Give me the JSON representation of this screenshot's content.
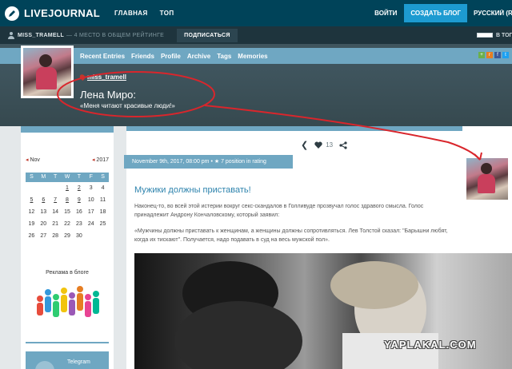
{
  "topbar": {
    "logo_text": "LIVEJOURNAL",
    "nav": [
      "ГЛАВНАЯ",
      "ТОП"
    ],
    "login": "ВОЙТИ",
    "create_blog": "СОЗДАТЬ БЛОГ",
    "language": "РУССКИЙ (RU)"
  },
  "journal_bar": {
    "username": "MISS_TRAMELL",
    "rank_text": "— 4 МЕСТО В ОБЩЕМ РЕЙТИНГЕ",
    "subscribe": "ПОДПИСАТЬСЯ",
    "right_label": "В ТОП"
  },
  "header": {
    "nav": [
      "Recent Entries",
      "Friends",
      "Profile",
      "Archive",
      "Tags",
      "Memories"
    ],
    "username_link": "miss_tramell",
    "blog_title": "Лена Миро:",
    "blog_subtitle": "«Меня читают красивые люди!»"
  },
  "calendar": {
    "prev_month": "Nov",
    "next_year": "2017",
    "weekdays": [
      "S",
      "M",
      "T",
      "W",
      "T",
      "F",
      "S"
    ],
    "days": [
      {
        "d": "",
        "link": false
      },
      {
        "d": "",
        "link": false
      },
      {
        "d": "",
        "link": false
      },
      {
        "d": "1",
        "link": true
      },
      {
        "d": "2",
        "link": true
      },
      {
        "d": "3",
        "link": false
      },
      {
        "d": "4",
        "link": false
      },
      {
        "d": "5",
        "link": true
      },
      {
        "d": "6",
        "link": true
      },
      {
        "d": "7",
        "link": true
      },
      {
        "d": "8",
        "link": true
      },
      {
        "d": "9",
        "link": true
      },
      {
        "d": "10",
        "link": false
      },
      {
        "d": "11",
        "link": false
      },
      {
        "d": "12",
        "link": false
      },
      {
        "d": "13",
        "link": false
      },
      {
        "d": "14",
        "link": false
      },
      {
        "d": "15",
        "link": false
      },
      {
        "d": "16",
        "link": false
      },
      {
        "d": "17",
        "link": false
      },
      {
        "d": "18",
        "link": false
      },
      {
        "d": "19",
        "link": false
      },
      {
        "d": "20",
        "link": false
      },
      {
        "d": "21",
        "link": false
      },
      {
        "d": "22",
        "link": false
      },
      {
        "d": "23",
        "link": false
      },
      {
        "d": "24",
        "link": false
      },
      {
        "d": "25",
        "link": false
      },
      {
        "d": "26",
        "link": false
      },
      {
        "d": "27",
        "link": false
      },
      {
        "d": "28",
        "link": false
      },
      {
        "d": "29",
        "link": false
      },
      {
        "d": "30",
        "link": false
      },
      {
        "d": "",
        "link": false
      },
      {
        "d": "",
        "link": false
      }
    ]
  },
  "sidebar": {
    "ad_label": "Реклама в блоге",
    "telegram": "Telegram"
  },
  "post": {
    "likes": "13",
    "date_tag": "November 9th, 2017, 08:00 pm • ★ 7 position in rating",
    "title": "Мужики должны приставать!",
    "p1": "Наконец-то, во всей этой истерии вокруг секс-скандалов в Голливуде прозвучал голос здравого смысла. Голос принадлежит Андрону Кончаловскому, который заявил:",
    "p2": "«Мужчины должны приставать к женщинам, а женщины должны сопротивляться. Лев Толстой сказал: \"Барышни любят, когда их тискают\". Получается, надо подавать в суд на весь мужской пол»."
  },
  "watermark": "YAPLAKAL.COM",
  "colors": {
    "topbar": "#004359",
    "accent": "#1d9bd1",
    "strip": "#6fa7c2",
    "annotation": "#d9262c"
  }
}
